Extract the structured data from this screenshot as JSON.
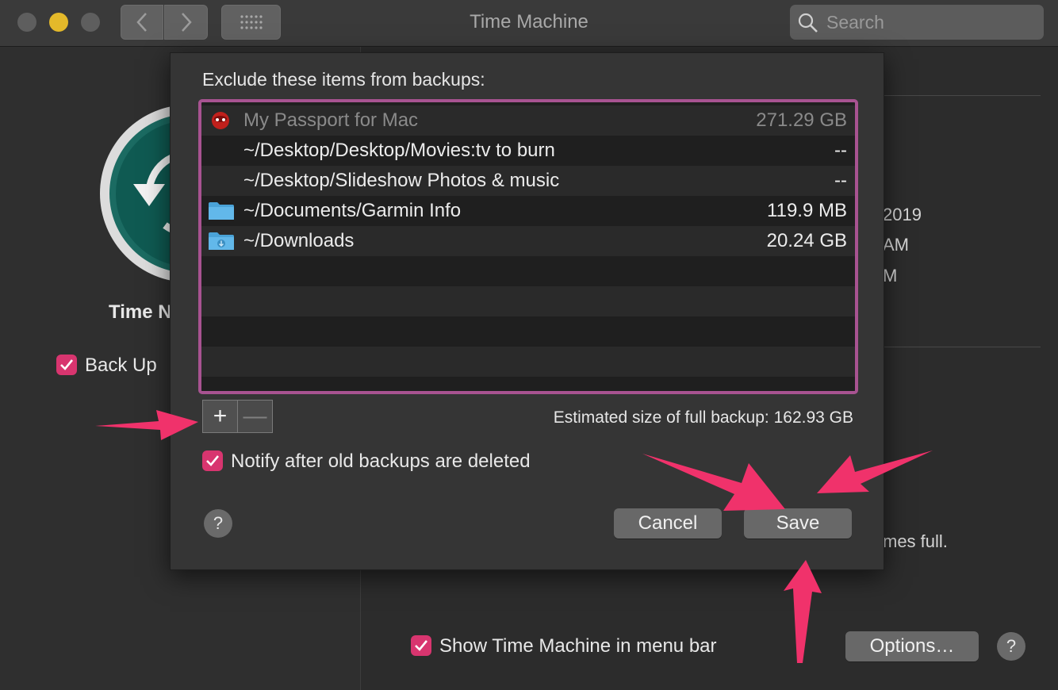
{
  "window": {
    "title": "Time Machine",
    "search_placeholder": "Search"
  },
  "background": {
    "app_name_partial": "Time N",
    "back_up_label": "Back Up",
    "right_partial_lines": [
      "2019",
      "AM",
      "M"
    ],
    "becomes_full_partial": "mes full.",
    "show_menu_bar_label": "Show Time Machine in menu bar",
    "options_label": "Options…",
    "help_label": "?"
  },
  "sheet": {
    "heading": "Exclude these items from backups:",
    "items": [
      {
        "path": "My Passport for Mac",
        "size": "271.29 GB",
        "icon": "drive-icon",
        "dim": true
      },
      {
        "path": "~/Desktop/Desktop/Movies:tv to burn",
        "size": "--",
        "icon": "",
        "dim": false
      },
      {
        "path": "~/Desktop/Slideshow Photos & music",
        "size": "--",
        "icon": "",
        "dim": false
      },
      {
        "path": "~/Documents/Garmin Info",
        "size": "119.9 MB",
        "icon": "folder-icon",
        "dim": false
      },
      {
        "path": "~/Downloads",
        "size": "20.24 GB",
        "icon": "downloads-folder-icon",
        "dim": false
      }
    ],
    "add_label": "+",
    "remove_label": "—",
    "estimate": "Estimated size of full backup: 162.93 GB",
    "notify_label": "Notify after old backups are deleted",
    "help_label": "?",
    "cancel_label": "Cancel",
    "save_label": "Save"
  },
  "colors": {
    "accent": "#d8356f",
    "list_focus_ring": "#a85391",
    "annotation_arrow": "#f0326b"
  }
}
